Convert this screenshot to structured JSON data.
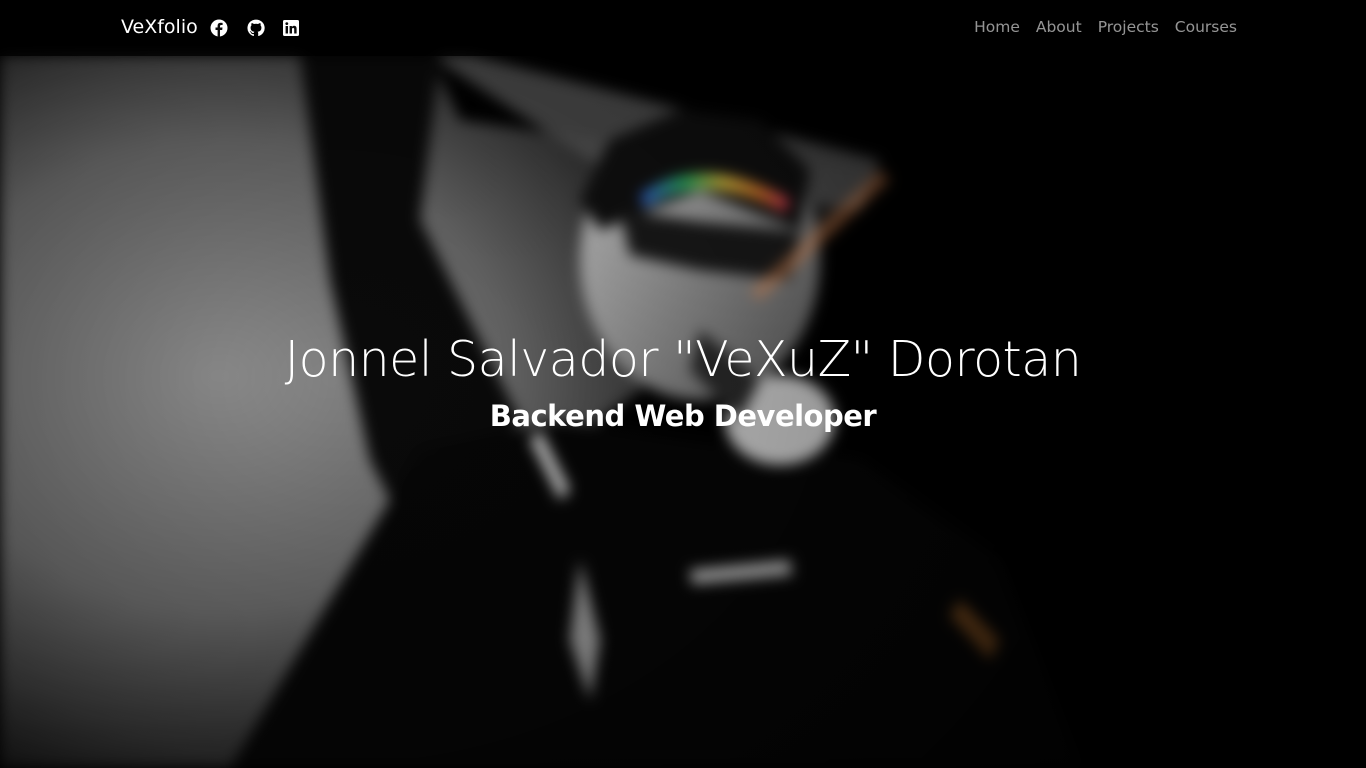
{
  "navbar": {
    "brand": "VeXfolio",
    "social": [
      {
        "name": "facebook",
        "icon": "facebook-icon"
      },
      {
        "name": "github",
        "icon": "github-icon"
      },
      {
        "name": "linkedin",
        "icon": "linkedin-icon"
      }
    ],
    "links": [
      "Home",
      "About",
      "Projects",
      "Courses"
    ]
  },
  "hero": {
    "title": "Jonnel Salvador \"VeXuZ\" Dorotan",
    "subtitle": "Backend Web Developer",
    "background": "blurred-monochrome-portrait-photo"
  },
  "colors": {
    "navbar_bg": "#0b0b0b",
    "text": "#ffffff",
    "nav_link": "#9a9a9a",
    "page_bg": "#000000"
  }
}
